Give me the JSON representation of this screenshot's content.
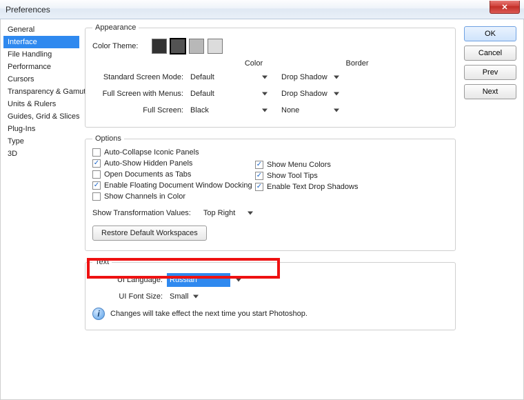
{
  "window": {
    "title": "Preferences"
  },
  "sidebar": {
    "items": [
      {
        "label": "General"
      },
      {
        "label": "Interface",
        "selected": true
      },
      {
        "label": "File Handling"
      },
      {
        "label": "Performance"
      },
      {
        "label": "Cursors"
      },
      {
        "label": "Transparency & Gamut"
      },
      {
        "label": "Units & Rulers"
      },
      {
        "label": "Guides, Grid & Slices"
      },
      {
        "label": "Plug-Ins"
      },
      {
        "label": "Type"
      },
      {
        "label": "3D"
      }
    ]
  },
  "buttons": {
    "ok": "OK",
    "cancel": "Cancel",
    "prev": "Prev",
    "next": "Next",
    "close": "✕",
    "restore": "Restore Default Workspaces"
  },
  "appearance": {
    "legend": "Appearance",
    "color_theme_label": "Color Theme:",
    "header_color": "Color",
    "header_border": "Border",
    "rows": [
      {
        "label": "Standard Screen Mode:",
        "color": "Default",
        "border": "Drop Shadow"
      },
      {
        "label": "Full Screen with Menus:",
        "color": "Default",
        "border": "Drop Shadow"
      },
      {
        "label": "Full Screen:",
        "color": "Black",
        "border": "None"
      }
    ]
  },
  "options": {
    "legend": "Options",
    "left": [
      {
        "label": "Auto-Collapse Iconic Panels",
        "checked": false
      },
      {
        "label": "Auto-Show Hidden Panels",
        "checked": true
      },
      {
        "label": "Open Documents as Tabs",
        "checked": false
      },
      {
        "label": "Enable Floating Document Window Docking",
        "checked": true
      },
      {
        "label": "Show Channels in Color",
        "checked": false
      }
    ],
    "right": [
      {
        "label": "Show Menu Colors",
        "checked": true
      },
      {
        "label": "Show Tool Tips",
        "checked": true
      },
      {
        "label": "Enable Text Drop Shadows",
        "checked": true
      }
    ],
    "transform_label": "Show Transformation Values:",
    "transform_value": "Top Right"
  },
  "text": {
    "legend": "Text",
    "ui_lang_label": "UI Language:",
    "ui_lang_value": "Russian",
    "ui_font_label": "UI Font Size:",
    "ui_font_value": "Small",
    "notice": "Changes will take effect the next time you start Photoshop."
  }
}
